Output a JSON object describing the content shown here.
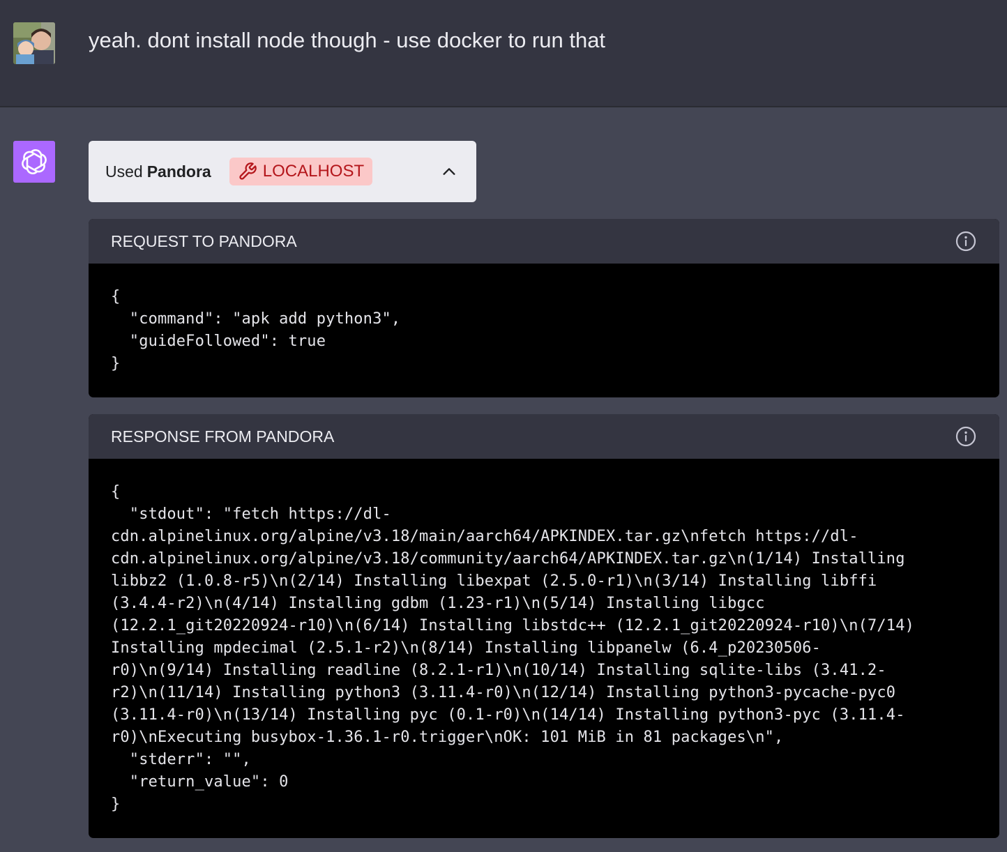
{
  "user_message": {
    "text": "yeah. dont install node though - use docker to run that"
  },
  "plugin_call": {
    "used_label": "Used",
    "plugin_name": "Pandora",
    "badge_label": "LOCALHOST",
    "toggle_icon": "chevron-up-icon"
  },
  "request_panel": {
    "title": "REQUEST TO PANDORA",
    "lines": [
      "{",
      "  \"command\": \"apk add python3\",",
      "  \"guideFollowed\": true",
      "}"
    ]
  },
  "response_panel": {
    "title": "RESPONSE FROM PANDORA",
    "lines": [
      "{",
      "  \"stdout\": \"fetch https://dl-",
      "cdn.alpinelinux.org/alpine/v3.18/main/aarch64/APKINDEX.tar.gz\\nfetch https://dl-",
      "cdn.alpinelinux.org/alpine/v3.18/community/aarch64/APKINDEX.tar.gz\\n(1/14) Installing",
      "libbz2 (1.0.8-r5)\\n(2/14) Installing libexpat (2.5.0-r1)\\n(3/14) Installing libffi",
      "(3.4.4-r2)\\n(4/14) Installing gdbm (1.23-r1)\\n(5/14) Installing libgcc",
      "(12.2.1_git20220924-r10)\\n(6/14) Installing libstdc++ (12.2.1_git20220924-r10)\\n(7/14)",
      "Installing mpdecimal (2.5.1-r2)\\n(8/14) Installing libpanelw (6.4_p20230506-",
      "r0)\\n(9/14) Installing readline (8.2.1-r1)\\n(10/14) Installing sqlite-libs (3.41.2-",
      "r2)\\n(11/14) Installing python3 (3.11.4-r0)\\n(12/14) Installing python3-pycache-pyc0",
      "(3.11.4-r0)\\n(13/14) Installing pyc (0.1-r0)\\n(14/14) Installing python3-pyc (3.11.4-",
      "r0)\\nExecuting busybox-1.36.1-r0.trigger\\nOK: 101 MiB in 81 packages\\n\",",
      "  \"stderr\": \"\",",
      "  \"return_value\": 0",
      "}"
    ]
  }
}
